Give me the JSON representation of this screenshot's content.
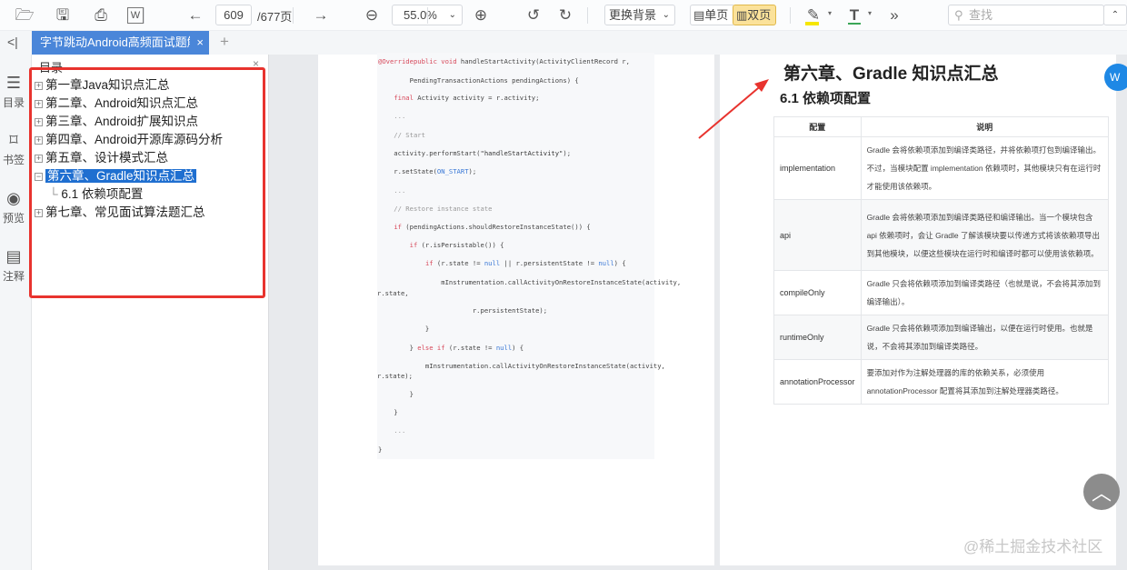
{
  "toolbar": {
    "page_current": "609",
    "page_total": "/677页",
    "zoom": "55.0%",
    "background_btn": "更换背景",
    "single_page": "单页",
    "double_page": "双页",
    "search_placeholder": "查找",
    "highlight_color": "#f5e600",
    "text_color": "#3aa657"
  },
  "tabs": [
    {
      "label": "字节跳动Android高频面试题解析"
    }
  ],
  "rail": [
    {
      "label": "目录",
      "icon": "toc-icon"
    },
    {
      "label": "书签",
      "icon": "bookmark-icon"
    },
    {
      "label": "预览",
      "icon": "eye-icon"
    },
    {
      "label": "注释",
      "icon": "comment-icon"
    }
  ],
  "sidebar": {
    "title": "目录",
    "items": [
      {
        "label": "第一章Java知识点汇总",
        "expanded": false
      },
      {
        "label": "第二章、Android知识点汇总",
        "expanded": false
      },
      {
        "label": "第三章、Android扩展知识点",
        "expanded": false
      },
      {
        "label": "第四章、Android开源库源码分析",
        "expanded": false
      },
      {
        "label": "第五章、设计模式汇总",
        "expanded": false
      },
      {
        "label": "第六章、Gradle知识点汇总",
        "expanded": true,
        "selected": true
      },
      {
        "label": "6.1 依赖项配置",
        "child": true
      },
      {
        "label": "第七章、常见面试算法题汇总",
        "expanded": false
      }
    ]
  },
  "code_lines": [
    [
      [
        "@Override",
        "kw"
      ],
      [
        "public void ",
        "kw"
      ],
      [
        "handleStartActivity(ActivityClientRecord r,",
        ""
      ]
    ],
    [
      [
        "        PendingTransactionActions pendingActions) {",
        ""
      ]
    ],
    [
      [
        "    ",
        ""
      ],
      [
        "final ",
        "kw"
      ],
      [
        "Activity activity = r.activity;",
        ""
      ]
    ],
    [
      [
        "    ...",
        "cm"
      ]
    ],
    [
      [
        "    // Start",
        "cm"
      ]
    ],
    [
      [
        "    activity.performStart(",
        ""
      ],
      [
        "\"handleStartActivity\"",
        "st"
      ],
      [
        ");",
        ""
      ]
    ],
    [
      [
        "    r.setState(",
        ""
      ],
      [
        "ON_START",
        "bl"
      ],
      [
        ");",
        ""
      ]
    ],
    [
      [
        "    ...",
        "cm"
      ]
    ],
    [
      [
        "    // Restore instance state",
        "cm"
      ]
    ],
    [
      [
        "    ",
        ""
      ],
      [
        "if ",
        "kw"
      ],
      [
        "(pendingActions.shouldRestoreInstanceState()) {",
        ""
      ]
    ],
    [
      [
        "        ",
        ""
      ],
      [
        "if ",
        "kw"
      ],
      [
        "(r.isPersistable()) {",
        ""
      ]
    ],
    [
      [
        "            ",
        ""
      ],
      [
        "if ",
        "kw"
      ],
      [
        "(r.state != ",
        ""
      ],
      [
        "null",
        "bl"
      ],
      [
        " || r.persistentState != ",
        ""
      ],
      [
        "null",
        "bl"
      ],
      [
        ") {",
        ""
      ]
    ],
    [
      [
        "                mInstrumentation.callActivityOnRestoreInstanceState(activity,",
        ""
      ]
    ],
    [
      [
        "r.state,",
        ""
      ]
    ],
    [
      [
        "                        r.persistentState);",
        ""
      ]
    ],
    [
      [
        "            }",
        ""
      ]
    ],
    [
      [
        "        } ",
        ""
      ],
      [
        "else if ",
        "kw"
      ],
      [
        "(r.state != ",
        ""
      ],
      [
        "null",
        "bl"
      ],
      [
        ") {",
        ""
      ]
    ],
    [
      [
        "            mInstrumentation.callActivityOnRestoreInstanceState(activity,",
        ""
      ]
    ],
    [
      [
        "r.state);",
        ""
      ]
    ],
    [
      [
        "        }",
        ""
      ]
    ],
    [
      [
        "    }",
        ""
      ]
    ],
    [
      [
        "    ...",
        "cm"
      ]
    ],
    [
      [
        "}",
        ""
      ]
    ]
  ],
  "right_page": {
    "chapter_title": "第六章、Gradle 知识点汇总",
    "section_title": "6.1 依赖项配置",
    "table": {
      "headers": [
        "配置",
        "说明"
      ],
      "rows": [
        [
          "implementation",
          "Gradle 会将依赖项添加到编译类路径，并将依赖项打包到编译输出。不过，当模块配置 implementation 依赖项时，其他模块只有在运行时才能使用该依赖项。"
        ],
        [
          "api",
          "Gradle 会将依赖项添加到编译类路径和编译输出。当一个模块包含 api 依赖项时，会让 Gradle 了解该模块要以传递方式将该依赖项导出到其他模块，以便这些模块在运行时和编译时都可以使用该依赖项。"
        ],
        [
          "compileOnly",
          "Gradle 只会将依赖项添加到编译类路径（也就是说，不会将其添加到编译输出）。"
        ],
        [
          "runtimeOnly",
          "Gradle 只会将依赖项添加到编译输出，以便在运行时使用。也就是说，不会将其添加到编译类路径。"
        ],
        [
          "annotationProcessor",
          "要添加对作为注解处理器的库的依赖关系，必须使用 annotationProcessor 配置将其添加到注解处理器类路径。"
        ]
      ]
    }
  },
  "watermark": "@稀土掘金技术社区"
}
